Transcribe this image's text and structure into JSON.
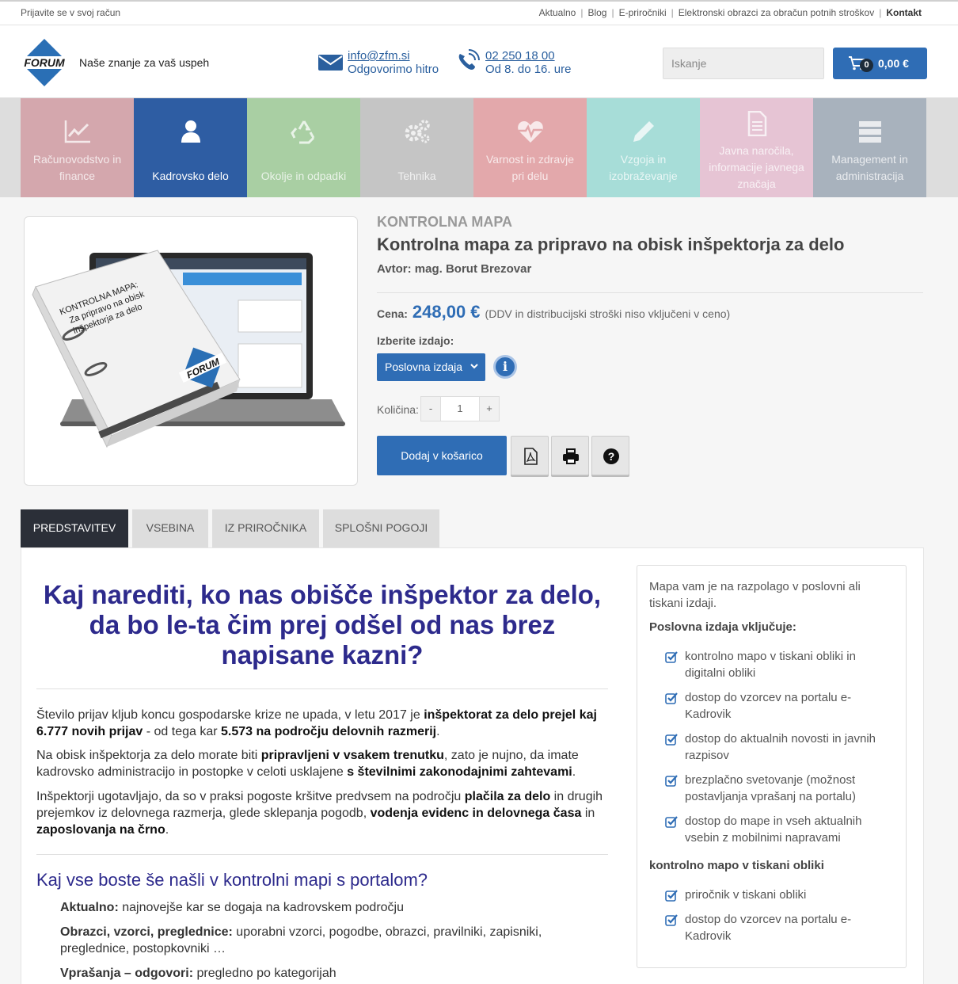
{
  "topbar": {
    "login": "Prijavite se v svoj račun",
    "links": [
      "Aktualno",
      "Blog",
      "E-priročniki",
      "Elektronski obrazci za obračun potnih stroškov",
      "Kontakt"
    ]
  },
  "header": {
    "logo_text": "FORUM",
    "tagline": "Naše znanje za vaš uspeh",
    "email": "info@zfm.si",
    "email_sub": "Odgovorimo hitro",
    "phone": "02 250 18 00",
    "phone_sub": "Od 8. do 16. ure",
    "search_placeholder": "Iskanje",
    "cart_count": "0",
    "cart_total": "0,00 €"
  },
  "categories": [
    {
      "label": "Računovodstvo in finance",
      "icon": "chart-icon",
      "color": "#d4a7ad"
    },
    {
      "label": "Kadrovsko delo",
      "icon": "user-icon",
      "color": "#2e5da3"
    },
    {
      "label": "Okolje in odpadki",
      "icon": "recycle-icon",
      "color": "#a9cfa3"
    },
    {
      "label": "Tehnika",
      "icon": "gears-icon",
      "color": "#c5c5c5"
    },
    {
      "label": "Varnost in zdravje pri delu",
      "icon": "heartbeat-icon",
      "color": "#e3a8ab"
    },
    {
      "label": "Vzgoja in izobraževanje",
      "icon": "pencil-icon",
      "color": "#a7ddd8"
    },
    {
      "label": "Javna naročila, informacije javnega značaja",
      "icon": "document-icon",
      "color": "#e6c4d4"
    },
    {
      "label": "Management in administracija",
      "icon": "server-icon",
      "color": "#a8b2bd"
    }
  ],
  "product": {
    "image_texts": [
      "KONTROLNA MAPA:",
      "Za pripravo na obisk",
      "inšpektorja za delo",
      "FORUM"
    ],
    "kicker": "KONTROLNA MAPA",
    "title": "Kontrolna mapa za pripravo na obisk inšpektorja za delo",
    "author_label": "Avtor:",
    "author": "mag. Borut Brezovar",
    "price_label": "Cena:",
    "price": "248,00 €",
    "price_note": "(DDV in distribucijski stroški niso vključeni v ceno)",
    "edition_label": "Izberite izdajo:",
    "edition_selected": "Poslovna izdaja",
    "info": "i",
    "qty_label": "Količina:",
    "qty_minus": "-",
    "qty_value": "1",
    "qty_plus": "+",
    "add_to_cart": "Dodaj v košarico"
  },
  "tabs": [
    "PREDSTAVITEV",
    "VSEBINA",
    "IZ PRIROČNIKA",
    "SPLOŠNI POGOJI"
  ],
  "content": {
    "headline": "Kaj narediti, ko nas obišče inšpektor za delo, da bo le-ta čim prej odšel od nas brez napisane kazni?",
    "p1": [
      {
        "t": "Število prijav kljub koncu gospodarske krize ne upada, v letu 2017 je "
      },
      {
        "t": "inšpektorat za delo prejel kaj 6.777 novih prijav",
        "b": true
      },
      {
        "t": " - od tega kar "
      },
      {
        "t": "5.573 na področju delovnih razmerij",
        "b": true
      },
      {
        "t": "."
      }
    ],
    "p2": [
      {
        "t": "Na obisk inšpektorja za delo morate biti "
      },
      {
        "t": "pripravljeni v vsakem trenutku",
        "b": true
      },
      {
        "t": ", zato je nujno, da imate kadrovsko administracijo in postopke v celoti usklajene "
      },
      {
        "t": "s številnimi zakonodajnimi zahtevami",
        "b": true
      },
      {
        "t": "."
      }
    ],
    "p3": [
      {
        "t": "Inšpektorji ugotavljajo, da so v praksi pogoste kršitve predvsem na področju "
      },
      {
        "t": "plačila za delo",
        "b": true
      },
      {
        "t": " in drugih prejemkov iz delovnega razmerja, glede sklepanja pogodb, "
      },
      {
        "t": "vodenja evidenc in delovnega časa",
        "b": true
      },
      {
        "t": " in "
      },
      {
        "t": "zaposlovanja na črno",
        "b": true
      },
      {
        "t": "."
      }
    ],
    "subheading": "Kaj vse boste še našli v kontrolni mapi s portalom?",
    "list": [
      {
        "term": "Aktualno:",
        "desc": " najnovejše kar se dogaja na kadrovskem področju"
      },
      {
        "term": "Obrazci, vzorci, preglednice:",
        "desc": " uporabni vzorci, pogodbe, obrazci, pravilniki, zapisniki, preglednice, postopkovniki …"
      },
      {
        "term": "Vprašanja – odgovori:",
        "desc": " pregledno po kategorijah"
      }
    ]
  },
  "sidebar": {
    "intro": "Mapa vam je na razpolago v poslovni ali tiskani izdaji.",
    "heading1": "Poslovna izdaja vključuje:",
    "items1": [
      "kontrolno mapo v tiskani obliki in digitalni obliki",
      "dostop do vzorcev na portalu e-Kadrovik",
      "dostop do aktualnih novosti in javnih razpisov",
      "brezplačno svetovanje (možnost postavljanja vprašanj na portalu)",
      "dostop do mape in vseh aktualnih vsebin z mobilnimi napravami"
    ],
    "heading2": "kontrolno mapo v tiskani obliki",
    "items2": [
      "priročnik v tiskani obliki",
      "dostop do vzorcev na portalu e-Kadrovik"
    ]
  },
  "colors": {
    "accent": "#2f6db5",
    "headline": "#2d2a8c",
    "tab_active": "#2b2f38"
  }
}
